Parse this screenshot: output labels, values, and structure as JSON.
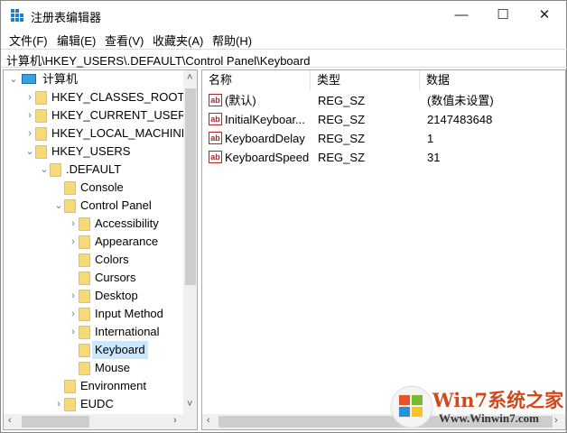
{
  "window": {
    "title": "注册表编辑器",
    "minimize": "—",
    "maximize": "☐",
    "close": "✕"
  },
  "menu": [
    "文件(F)",
    "编辑(E)",
    "查看(V)",
    "收藏夹(A)",
    "帮助(H)"
  ],
  "address": "计算机\\HKEY_USERS\\.DEFAULT\\Control Panel\\Keyboard",
  "tree": [
    {
      "label": "计算机",
      "level": 0,
      "expander": "⌄"
    },
    {
      "label": "HKEY_CLASSES_ROOT",
      "level": 1,
      "expander": "›"
    },
    {
      "label": "HKEY_CURRENT_USER",
      "level": 1,
      "expander": "›"
    },
    {
      "label": "HKEY_LOCAL_MACHINE",
      "level": 1,
      "expander": "›"
    },
    {
      "label": "HKEY_USERS",
      "level": 1,
      "expander": "⌄"
    },
    {
      "label": ".DEFAULT",
      "level": 2,
      "expander": "⌄"
    },
    {
      "label": "Console",
      "level": 3,
      "expander": ""
    },
    {
      "label": "Control Panel",
      "level": 3,
      "expander": "⌄"
    },
    {
      "label": "Accessibility",
      "level": 4,
      "expander": "›"
    },
    {
      "label": "Appearance",
      "level": 4,
      "expander": "›"
    },
    {
      "label": "Colors",
      "level": 4,
      "expander": ""
    },
    {
      "label": "Cursors",
      "level": 4,
      "expander": ""
    },
    {
      "label": "Desktop",
      "level": 4,
      "expander": "›"
    },
    {
      "label": "Input Method",
      "level": 4,
      "expander": "›"
    },
    {
      "label": "International",
      "level": 4,
      "expander": "›"
    },
    {
      "label": "Keyboard",
      "level": 4,
      "expander": "",
      "selected": true
    },
    {
      "label": "Mouse",
      "level": 4,
      "expander": ""
    },
    {
      "label": "Environment",
      "level": 3,
      "expander": ""
    },
    {
      "label": "EUDC",
      "level": 3,
      "expander": "›"
    }
  ],
  "columns": {
    "name": "名称",
    "type": "类型",
    "data": "数据"
  },
  "values": [
    {
      "name": "(默认)",
      "type": "REG_SZ",
      "data": "(数值未设置)"
    },
    {
      "name": "InitialKeyboar...",
      "type": "REG_SZ",
      "data": "2147483648"
    },
    {
      "name": "KeyboardDelay",
      "type": "REG_SZ",
      "data": "1"
    },
    {
      "name": "KeyboardSpeed",
      "type": "REG_SZ",
      "data": "31"
    }
  ],
  "value_icon": "ab",
  "watermark": {
    "brand": "Win7系统之家",
    "url": "Www.Winwin7.com"
  }
}
